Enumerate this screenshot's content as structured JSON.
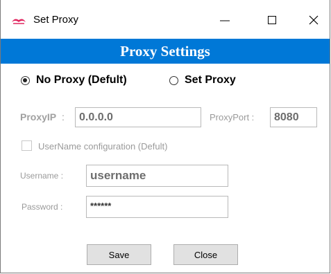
{
  "window": {
    "title": "Set Proxy",
    "minimize_symbol": "—",
    "close_symbol": "✕"
  },
  "header": {
    "title": "Proxy Settings",
    "background": "#0078d7"
  },
  "proxy_mode": {
    "options": [
      {
        "label": "No Proxy (Defult)",
        "checked": true
      },
      {
        "label": "Set Proxy",
        "checked": false
      }
    ]
  },
  "proxy": {
    "ip_label": "ProxyIP",
    "ip_separator": ":",
    "ip_value": "0.0.0.0",
    "port_label": "ProxyPort :",
    "port_value": "8080"
  },
  "auth": {
    "config_label": "UserName configuration (Defult)",
    "config_checked": false,
    "username_label": "Username :",
    "username_value": "username",
    "password_label": "Password :",
    "password_value": "******"
  },
  "buttons": {
    "save": "Save",
    "close": "Close"
  }
}
